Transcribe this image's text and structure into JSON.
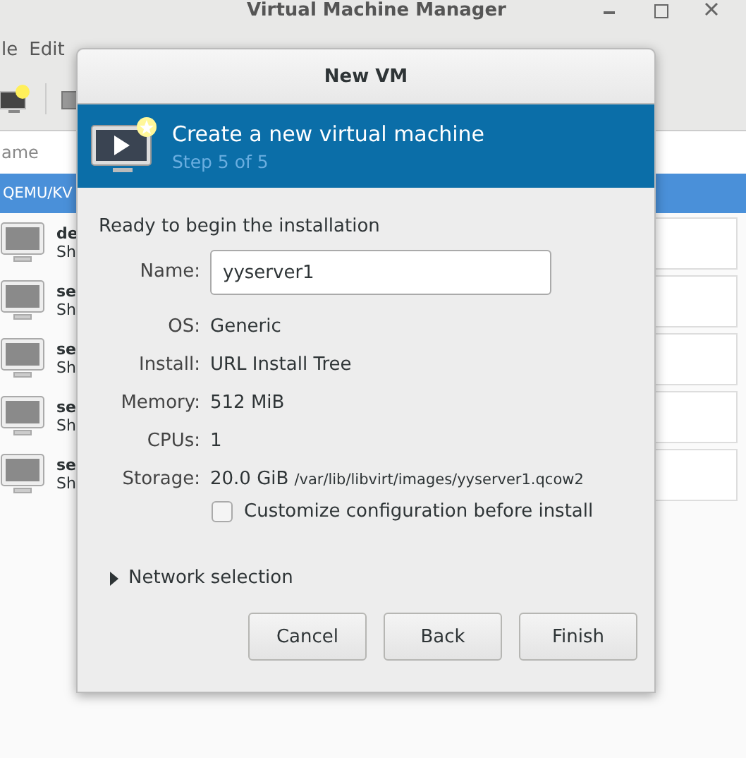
{
  "background_window": {
    "title": "Virtual Machine Manager",
    "menu": [
      "le",
      "Edit"
    ],
    "list_header": "ame",
    "connection": {
      "label": "QEMU/KV",
      "selected": true
    },
    "vms": [
      {
        "name": "de",
        "status": "Sh"
      },
      {
        "name": "se",
        "status": "Sh"
      },
      {
        "name": "se",
        "status": "Sh"
      },
      {
        "name": "se",
        "status": "Sh"
      },
      {
        "name": "se",
        "status": "Sh"
      }
    ]
  },
  "dialog": {
    "title": "New VM",
    "banner": {
      "heading": "Create a new virtual machine",
      "step": "Step 5 of 5"
    },
    "intro": "Ready to begin the installation",
    "name_field": {
      "label": "Name:",
      "value": "yyserver1"
    },
    "details": [
      {
        "label": "OS:",
        "value": "Generic"
      },
      {
        "label": "Install:",
        "value": "URL Install Tree"
      },
      {
        "label": "Memory:",
        "value": "512 MiB"
      },
      {
        "label": "CPUs:",
        "value": "1"
      },
      {
        "label": "Storage:",
        "value": "20.0 GiB",
        "path": "/var/lib/libvirt/images/yyserver1.qcow2"
      }
    ],
    "customize": {
      "label": "Customize configuration before install",
      "checked": false
    },
    "network": {
      "label": "Network selection",
      "expanded": false
    },
    "buttons": [
      "Cancel",
      "Back",
      "Finish"
    ]
  }
}
